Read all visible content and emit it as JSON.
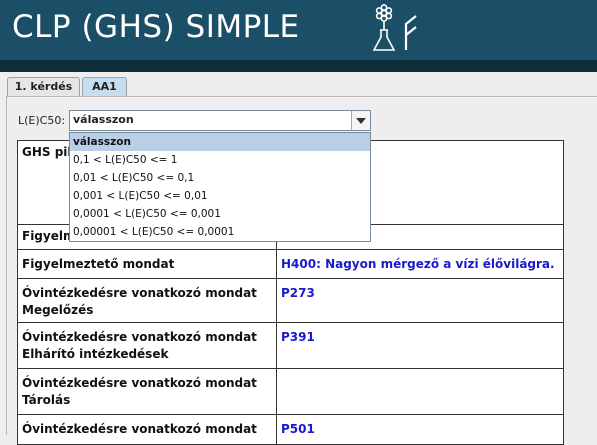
{
  "header": {
    "title": "CLP (GHS) SIMPLE"
  },
  "tabs": [
    {
      "label": "1. kérdés"
    },
    {
      "label": "AA1",
      "active": true
    }
  ],
  "form": {
    "field_label": "L(E)C50:",
    "selected_value": "válasszon",
    "options": [
      "válasszon",
      "0,1 < L(E)C50 <= 1",
      "0,01 < L(E)C50 <= 0,1",
      "0,001 < L(E)C50 <= 0,01",
      "0,0001 < L(E)C50 <= 0,001",
      "0,00001 < L(E)C50 <= 0,0001"
    ]
  },
  "table": {
    "rows": [
      {
        "label": "GHS piktogram",
        "value": ""
      },
      {
        "label": "Figyelmeztetés",
        "value": ""
      },
      {
        "label": "Figyelmeztető mondat",
        "value": "H400: Nagyon mérgező a vízi élővilágra."
      },
      {
        "label": "Óvintézkedésre vonatkozó mondat",
        "sublabel": "Megelőzés",
        "value": "P273"
      },
      {
        "label": "Óvintézkedésre vonatkozó mondat",
        "sublabel": "Elhárító intézkedések",
        "value": "P391"
      },
      {
        "label": "Óvintézkedésre vonatkozó mondat",
        "sublabel": "Tárolás",
        "value": ""
      },
      {
        "label": "Óvintézkedésre vonatkozó mondat",
        "value": "P501"
      }
    ]
  },
  "colors": {
    "header_bg": "#1b4f67",
    "value_text": "#1a1acc",
    "selected_option": "#b8cfe5"
  },
  "icons": [
    "flask-flower-logo",
    "chevron-down-icon"
  ]
}
